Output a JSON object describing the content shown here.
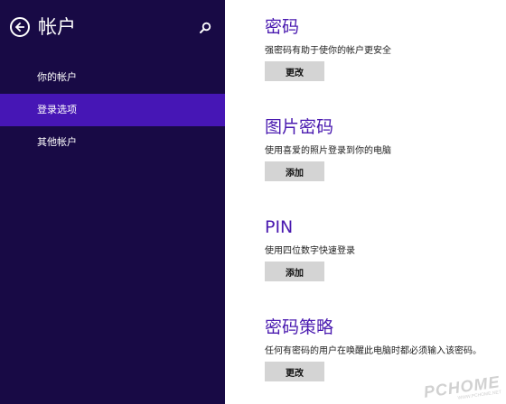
{
  "sidebar": {
    "title": "帐户",
    "items": [
      {
        "label": "你的帐户",
        "active": false
      },
      {
        "label": "登录选项",
        "active": true
      },
      {
        "label": "其他帐户",
        "active": false
      }
    ]
  },
  "sections": [
    {
      "title": "密码",
      "desc": "强密码有助于使你的帐户更安全",
      "button": "更改"
    },
    {
      "title": "图片密码",
      "desc": "使用喜爱的照片登录到你的电脑",
      "button": "添加"
    },
    {
      "title": "PIN",
      "desc": "使用四位数字快速登录",
      "button": "添加"
    },
    {
      "title": "密码策略",
      "desc": "任何有密码的用户在唤醒此电脑时都必须输入该密码。",
      "button": "更改"
    }
  ],
  "watermark": {
    "text": "PCHOME",
    "subtext": "WWW.PCHOME.NET"
  },
  "colors": {
    "sidebar_bg": "#180a45",
    "active_item_bg": "#4616b5",
    "accent_text": "#4a1ab0",
    "button_bg": "#d4d4d4"
  },
  "icons": {
    "back": "back-arrow-circle-icon",
    "search": "search-icon"
  }
}
